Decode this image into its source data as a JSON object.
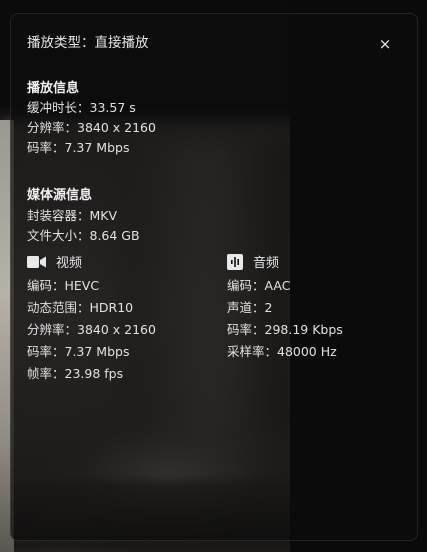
{
  "header": {
    "title": "播放类型：直接播放",
    "close_label": "×"
  },
  "playback_info": {
    "title": "播放信息",
    "lines": [
      "缓冲时长：33.57 s",
      "分辨率：3840 x 2160",
      "码率：7.37 Mbps"
    ]
  },
  "media_source": {
    "title": "媒体源信息",
    "lines": [
      "封装容器：MKV",
      "文件大小：8.64 GB"
    ],
    "video": {
      "icon": "video-camera-icon",
      "title": "视频",
      "lines": [
        "编码：HEVC",
        "动态范围：HDR10",
        "分辨率：3840 x 2160",
        "码率：7.37 Mbps",
        "帧率：23.98 fps"
      ]
    },
    "audio": {
      "icon": "audio-waveform-icon",
      "title": "音频",
      "lines": [
        "编码：AAC",
        "声道：2",
        "码率：298.19 Kbps",
        "采样率：48000 Hz"
      ]
    }
  }
}
